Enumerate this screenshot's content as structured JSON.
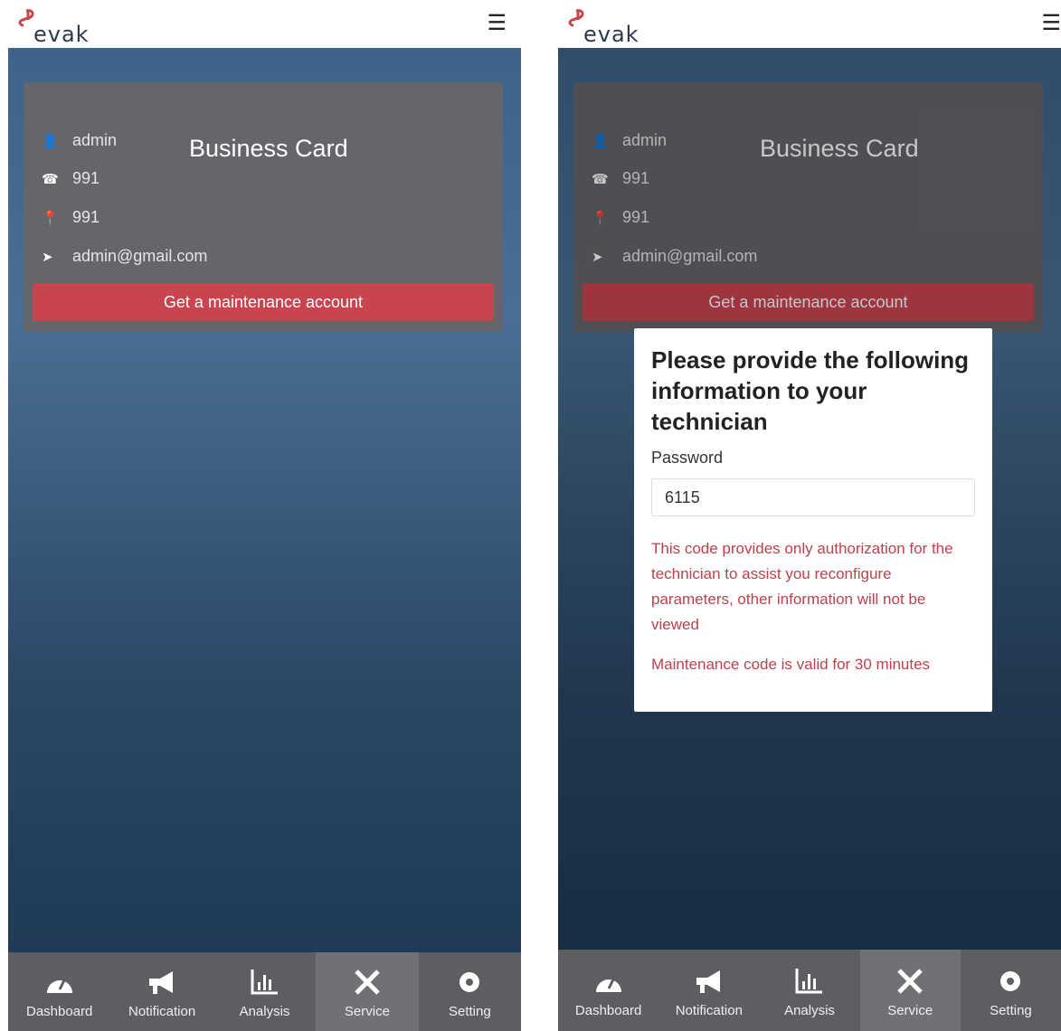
{
  "app": {
    "brand": "evak",
    "accent": "#c8444f"
  },
  "card": {
    "title": "Business Card",
    "user": "admin",
    "phone": "991",
    "location": "991",
    "email": "admin@gmail.com",
    "button": "Get a maintenance account"
  },
  "nav": {
    "items": [
      {
        "label": "Dashboard",
        "icon": "gauge-icon"
      },
      {
        "label": "Notification",
        "icon": "megaphone-icon"
      },
      {
        "label": "Analysis",
        "icon": "bar-chart-icon"
      },
      {
        "label": "Service",
        "icon": "tools-icon",
        "active": true
      },
      {
        "label": "Setting",
        "icon": "gear-icon"
      }
    ]
  },
  "modal": {
    "title": "Please provide the following information to your technician",
    "password_label": "Password",
    "password_value": "6115",
    "note": "This code provides only authorization for the technician to assist you reconfigure parameters, other information will not be viewed",
    "valid": "Maintenance code is valid for 30 minutes"
  }
}
